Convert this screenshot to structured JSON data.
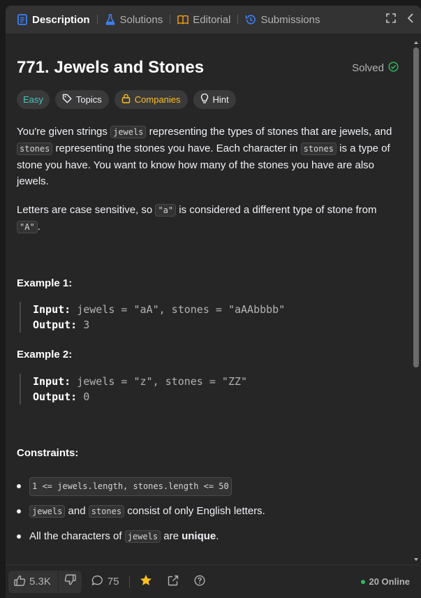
{
  "tabs": [
    {
      "label": "Description",
      "icon": "description-icon",
      "active": true
    },
    {
      "label": "Solutions",
      "icon": "flask-icon"
    },
    {
      "label": "Editorial",
      "icon": "book-icon"
    },
    {
      "label": "Submissions",
      "icon": "history-icon"
    }
  ],
  "problem": {
    "title": "771. Jewels and Stones",
    "status": "Solved"
  },
  "tags": {
    "difficulty": "Easy",
    "topics": "Topics",
    "companies": "Companies",
    "hint": "Hint"
  },
  "description": {
    "p1": {
      "t1": "You're given strings ",
      "c1": "jewels",
      "t2": " representing the types of stones that are jewels, and ",
      "c2": "stones",
      "t3": " representing the stones you have. Each character in ",
      "c3": "stones",
      "t4": " is a type of stone you have. You want to know how many of the stones you have are also jewels."
    },
    "p2": {
      "t1": "Letters are case sensitive, so ",
      "c1": "\"a\"",
      "t2": " is considered a different type of stone from ",
      "c2": "\"A\"",
      "t3": "."
    }
  },
  "examples": [
    {
      "title": "Example 1:",
      "input_label": "Input:",
      "input": "jewels = \"aA\", stones = \"aAAbbbb\"",
      "output_label": "Output:",
      "output": "3"
    },
    {
      "title": "Example 2:",
      "input_label": "Input:",
      "input": "jewels = \"z\", stones = \"ZZ\"",
      "output_label": "Output:",
      "output": "0"
    }
  ],
  "constraints": {
    "title": "Constraints:",
    "c1": "1 <= jewels.length, stones.length <= 50",
    "c2_code1": "jewels",
    "c2_t1": " and ",
    "c2_code2": "stones",
    "c2_t2": " consist of only English letters.",
    "c3_t1": "All the characters of ",
    "c3_code": "jewels",
    "c3_t2": " are ",
    "c3_bold": "unique",
    "c3_t3": "."
  },
  "footer": {
    "likes": "5.3K",
    "comments": "75",
    "online": "20 Online"
  },
  "colors": {
    "accent": "#46c6c2",
    "solved": "#2cbb5d",
    "companies": "#ffc01e",
    "star": "#ffc01e"
  }
}
